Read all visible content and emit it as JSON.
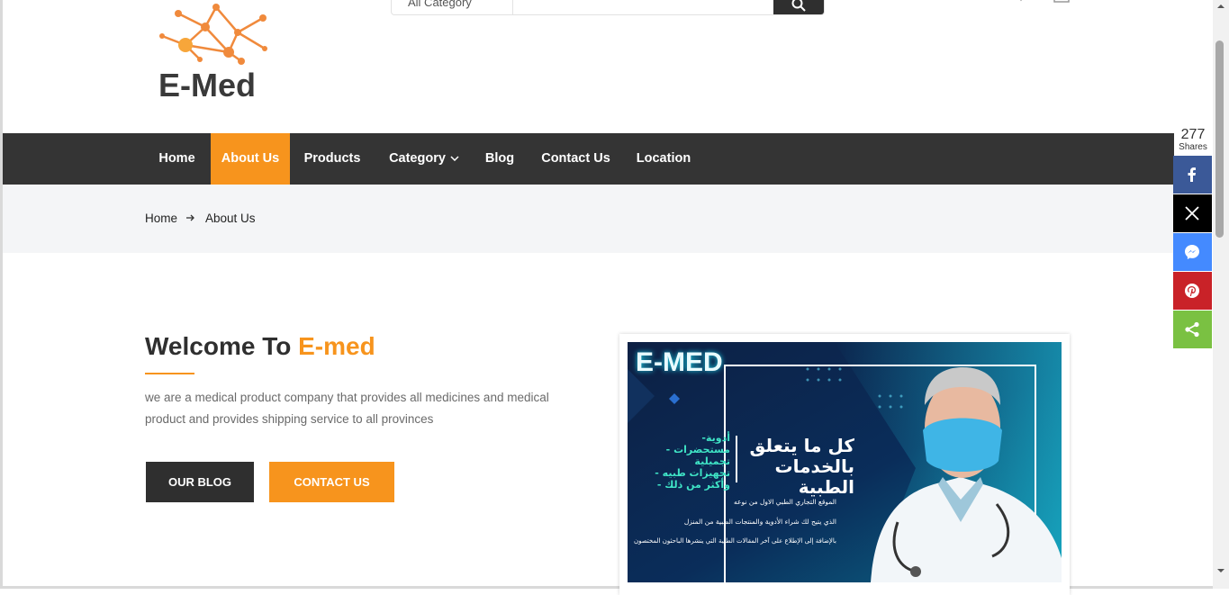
{
  "logo": {
    "text": "E-Med"
  },
  "search": {
    "category_label": "All Category",
    "placeholder": ""
  },
  "nav": {
    "items": [
      {
        "label": "Home"
      },
      {
        "label": "About Us"
      },
      {
        "label": "Products"
      },
      {
        "label": "Category"
      },
      {
        "label": "Blog"
      },
      {
        "label": "Contact Us"
      },
      {
        "label": "Location"
      }
    ],
    "active": "About Us"
  },
  "breadcrumb": {
    "home": "Home",
    "current": "About Us"
  },
  "welcome": {
    "title_prefix": "Welcome To ",
    "title_accent": "E-med",
    "description": "we are a medical product company that provides all medicines and medical product and provides shipping service to all provinces",
    "blog_button": "OUR BLOG",
    "contact_button": "CONTACT US"
  },
  "banner": {
    "brand": "E-MED",
    "headline_line1": "كل ما يتعلق",
    "headline_line2": "بالخدمات الطبية",
    "list": [
      "-أدوية",
      "- مستحضرات تجميلية",
      "- تجهيزات طبيه",
      "- وأكثر من ذلك"
    ],
    "line1": "الموقع التجاري الطبي الاول من نوعه",
    "line2": "الذي يتيح لك شراء الأدوية والمنتجات الطبية من المنزل",
    "line3": "بالإضافة إلى الإطلاع على آخر المقالات الطبية التي ينشرها الباحثون المختصون"
  },
  "share": {
    "count": "277",
    "label": "Shares",
    "buttons": [
      {
        "name": "facebook",
        "color": "#3b5998"
      },
      {
        "name": "x",
        "color": "#000000"
      },
      {
        "name": "messenger",
        "color": "#448aff"
      },
      {
        "name": "pinterest",
        "color": "#c92228"
      },
      {
        "name": "share",
        "color": "#7ac142"
      }
    ]
  },
  "colors": {
    "accent": "#f7941d",
    "dark": "#343434",
    "breadcrumb_bg": "#f4f5f7"
  }
}
